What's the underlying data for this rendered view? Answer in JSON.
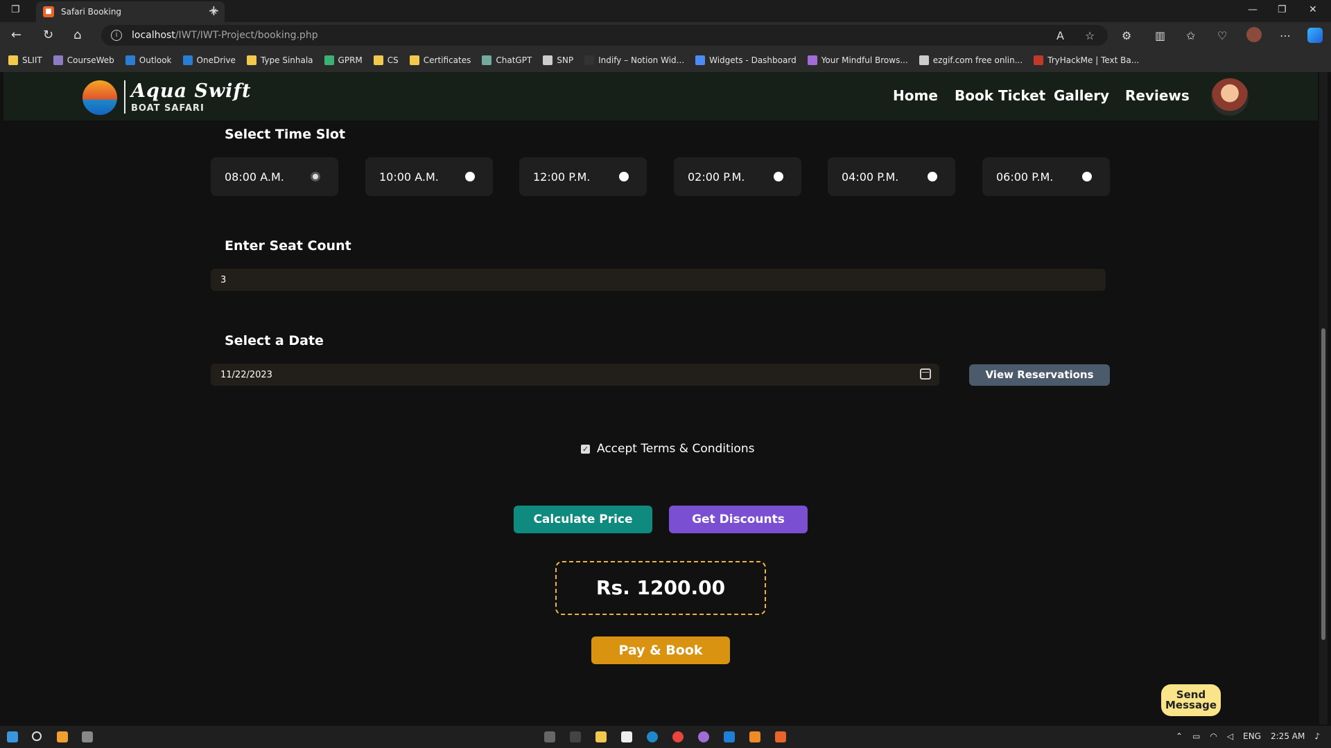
{
  "browser": {
    "tab_title": "Safari Booking",
    "tab_close": "✕",
    "new_tab": "+",
    "url_host": "localhost",
    "url_path": "/IWT/IWT-Project/booking.php",
    "bookmarks": [
      {
        "label": "SLIIT",
        "color": "#f2c94c"
      },
      {
        "label": "CourseWeb",
        "color": "#8e7cc3"
      },
      {
        "label": "Outlook",
        "color": "#2b7cd3"
      },
      {
        "label": "OneDrive",
        "color": "#2b7cd3"
      },
      {
        "label": "Type Sinhala",
        "color": "#f2c94c"
      },
      {
        "label": "GPRM",
        "color": "#3bb273"
      },
      {
        "label": "CS",
        "color": "#f2c94c"
      },
      {
        "label": "Certificates",
        "color": "#f2c94c"
      },
      {
        "label": "ChatGPT",
        "color": "#74aa9c"
      },
      {
        "label": "SNP",
        "color": "#cccccc"
      },
      {
        "label": "Indify – Notion Wid...",
        "color": "#333333"
      },
      {
        "label": "Widgets - Dashboard",
        "color": "#4c8bf5"
      },
      {
        "label": "Your Mindful Brows...",
        "color": "#a06cd5"
      },
      {
        "label": "ezgif.com free onlin...",
        "color": "#cccccc"
      },
      {
        "label": "TryHackMe | Text Ba...",
        "color": "#c0392b"
      }
    ]
  },
  "site": {
    "brand": "Aqua Swift",
    "brand_sub": "BOAT SAFARI",
    "nav": [
      "Home",
      "Book Ticket",
      "Gallery",
      "Reviews"
    ]
  },
  "booking": {
    "time_slot_label": "Select Time Slot",
    "time_slots": [
      {
        "label": "08:00 A.M.",
        "selected": true
      },
      {
        "label": "10:00 A.M.",
        "selected": false
      },
      {
        "label": "12:00 P.M.",
        "selected": false
      },
      {
        "label": "02:00 P.M.",
        "selected": false
      },
      {
        "label": "04:00 P.M.",
        "selected": false
      },
      {
        "label": "06:00 P.M.",
        "selected": false
      }
    ],
    "seat_label": "Enter Seat Count",
    "seat_value": "3",
    "date_label": "Select a Date",
    "date_value": "11/22/2023",
    "view_reservations": "View Reservations",
    "terms": "Accept Terms & Conditions",
    "terms_checked": true,
    "calculate_price": "Calculate Price",
    "get_discounts": "Get Discounts",
    "price": "Rs. 1200.00",
    "pay_book": "Pay & Book",
    "send_message": "Send Message"
  },
  "taskbar": {
    "lang": "ENG",
    "time": "2:25 AM"
  },
  "colors": {
    "calculate": "#0f8a7e",
    "discounts": "#7a4fd1",
    "pay": "#d99310",
    "price_border": "#f2b33a",
    "view_res": "#4c5b6b"
  }
}
